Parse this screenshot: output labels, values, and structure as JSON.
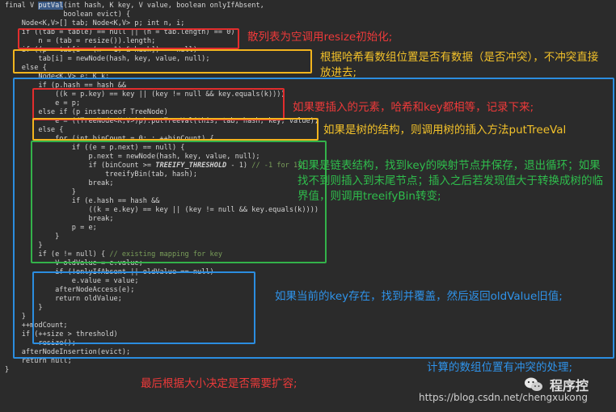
{
  "code": {
    "l0": {
      "a": "final V ",
      "name": "putVal",
      "b": "(int hash, K key, V value, boolean onlyIfAbsent,"
    },
    "l1": "              boolean evict) {",
    "l2": "    Node<K,V>[] tab; Node<K,V> p; int n, i;",
    "l3": "    if ((tab = table) == null || (n = tab.length) == 0)",
    "l4": "        n = (tab = resize()).length;",
    "l5": "    if ((p = tab[i = (n - 1) & hash]) == null)",
    "l6": "        tab[i] = newNode(hash, key, value, null);",
    "l7": "    else {",
    "l8": "        Node<K,V> e; K k;",
    "l9": "        if (p.hash == hash &&",
    "l10": "            ((k = p.key) == key || (key != null && key.equals(k))))",
    "l11": "            e = p;",
    "l12": "        else if (p instanceof TreeNode)",
    "l13": "            e = ((TreeNode<K,V>)p).putTreeVal(this, tab, hash, key, value);",
    "l14": "        else {",
    "l15": "            for (int binCount = 0; ; ++binCount) {",
    "l16": "                if ((e = p.next) == null) {",
    "l17": "                    p.next = newNode(hash, key, value, null);",
    "l18": {
      "a": "                    if (binCount >= ",
      "b": "TREEIFY_THRESHOLD",
      "c": " - 1) ",
      "d": "// -1 for 1st"
    },
    "l19": "                        treeifyBin(tab, hash);",
    "l20": "                    break;",
    "l21": "                }",
    "l22": "                if (e.hash == hash &&",
    "l23": "                    ((k = e.key) == key || (key != null && key.equals(k))))",
    "l24": "                    break;",
    "l25": "                p = e;",
    "l26": "            }",
    "l27": "        }",
    "l28": {
      "a": "        if (e != null) { ",
      "b": "// existing mapping for key"
    },
    "l29": "            V oldValue = e.value;",
    "l30": "            if (!onlyIfAbsent || oldValue == null)",
    "l31": "                e.value = value;",
    "l32": "            afterNodeAccess(e);",
    "l33": "            return oldValue;",
    "l34": "        }",
    "l35": "    }",
    "l36": "    ++modCount;",
    "l37": "    if (++size > threshold)",
    "l38": "        resize();",
    "l39": "    afterNodeInsertion(evict);",
    "l40": "    return null;",
    "l41": "}"
  },
  "notes": {
    "resize_init": "散列表为空调用resize初始化;",
    "hash_position": "根据哈希看数组位置是否有数据（是否冲突），不冲突直接放进去;",
    "key_equal": "如果要插入的元素，哈希和key都相等，记录下来;",
    "tree_insert": "如果是树的结构，则调用树的插入方法putTreeVal",
    "list_insert": "如果是链表结构，找到key的映射节点并保存，退出循环；如果找不到则插入到末尾节点；插入之后若发现值大于转换成树的临界值，则调用treeifyBin转变;",
    "key_exists": "如果当前的key存在，找到并覆盖，然后返回oldValue旧值;",
    "collision": "计算的数组位置有冲突的处理;",
    "expand": "最后根据大小决定是否需要扩容;"
  },
  "watermark": {
    "title": "程序控",
    "url": "https://blog.csdn.net/chengxukong",
    "icon": "wechat-icon"
  },
  "colors": {
    "background": "#2b2b2b",
    "red": "#e22d2d",
    "yellow": "#f2b41e",
    "blue": "#2b8de0",
    "green": "#33b24a"
  }
}
